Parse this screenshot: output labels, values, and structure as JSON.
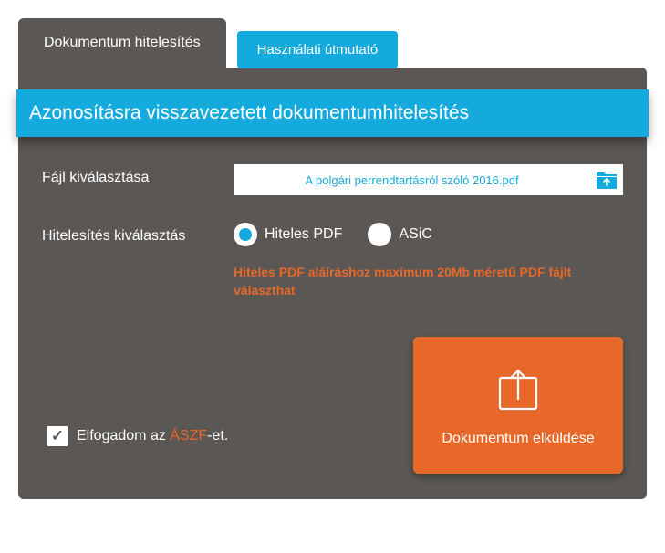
{
  "tabs": {
    "active": "Dokumentum hitelesítés",
    "inactive": "Használati útmutató"
  },
  "title": "Azonosításra visszavezetett dokumentumhitelesítés",
  "file": {
    "label": "Fájl kiválasztása",
    "name": "A polgári perrendtartásról szóló 2016.pdf"
  },
  "auth": {
    "label": "Hitelesítés kiválasztás",
    "options": {
      "pdf": "Hiteles PDF",
      "asic": "ASiC"
    },
    "warning": "Hiteles PDF aláíráshoz maximum 20Mb méretű PDF fájlt választhat"
  },
  "terms": {
    "prefix": "Elfogadom az ",
    "link": "ÁSZF",
    "suffix": "-et."
  },
  "submit": "Dokumentum elküldése"
}
